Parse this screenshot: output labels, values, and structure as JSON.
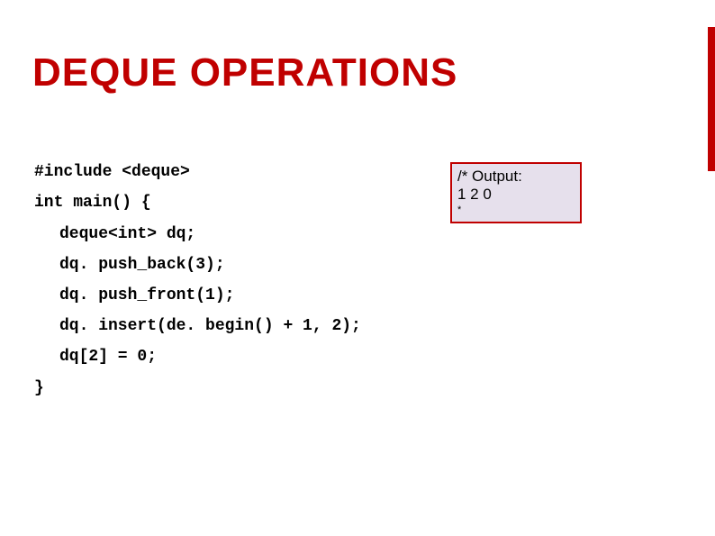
{
  "title": "DEQUE OPERATIONS",
  "code": {
    "lines": [
      "#include <deque>",
      "int main() {",
      "deque<int> dq;",
      "dq. push_back(3);",
      "dq. push_front(1);",
      "dq. insert(de. begin() + 1, 2);",
      "dq[2] = 0;",
      "}"
    ]
  },
  "output": {
    "lines": [
      "/* Output:",
      "1 2 0",
      "*"
    ]
  },
  "colors": {
    "accent": "#c00000",
    "output_bg": "#e6e0ec",
    "output_border": "#c00000"
  }
}
